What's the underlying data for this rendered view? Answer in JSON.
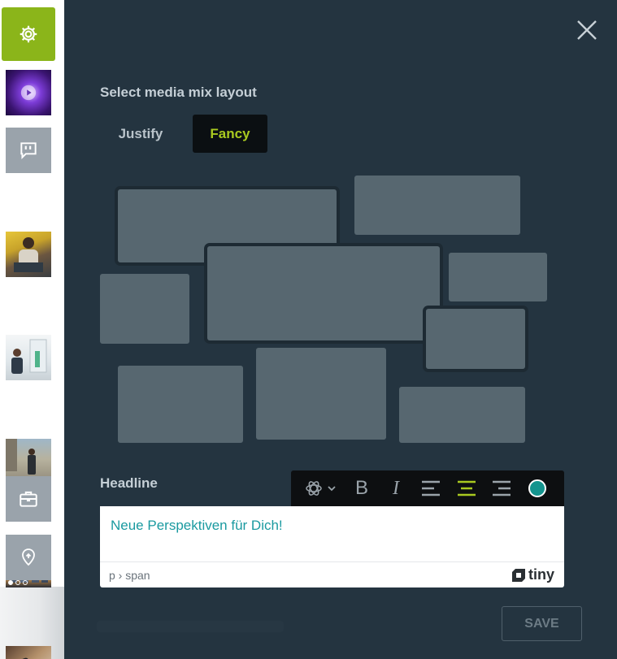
{
  "sidebar": {
    "items": [
      {
        "name": "settings",
        "icon": "gear-icon"
      },
      {
        "name": "video",
        "icon": "play-icon"
      },
      {
        "name": "quote",
        "icon": "quote-icon"
      },
      {
        "name": "image-yellow-chair"
      },
      {
        "name": "image-presenter"
      },
      {
        "name": "image-street"
      },
      {
        "name": "image-skyline",
        "number": "123"
      },
      {
        "name": "image-phone"
      },
      {
        "name": "briefcase",
        "icon": "briefcase-icon"
      },
      {
        "name": "location",
        "icon": "location-pin-icon"
      }
    ]
  },
  "panel": {
    "title": "Select media mix layout",
    "tabs": [
      {
        "label": "Justify",
        "active": false
      },
      {
        "label": "Fancy",
        "active": true
      }
    ],
    "headline_label": "Headline",
    "editor": {
      "content": "Neue Perspektiven für Dich!",
      "path": "p › span",
      "brand": "tiny"
    },
    "toolbar": [
      {
        "name": "ai-assistant",
        "icon": "openai-icon"
      },
      {
        "name": "bold",
        "label": "B"
      },
      {
        "name": "italic",
        "label": "I"
      },
      {
        "name": "align-left",
        "icon": "align-left-icon"
      },
      {
        "name": "align-center",
        "icon": "align-center-icon",
        "active": true
      },
      {
        "name": "align-right",
        "icon": "align-right-icon"
      },
      {
        "name": "text-color",
        "icon": "color-dot-icon",
        "color": "#14948e"
      }
    ],
    "save_label": "SAVE"
  },
  "colors": {
    "accent": "#8bb51a",
    "panel_bg": "#243440",
    "tile": "#576770",
    "editor_text": "#1a9aa0"
  }
}
